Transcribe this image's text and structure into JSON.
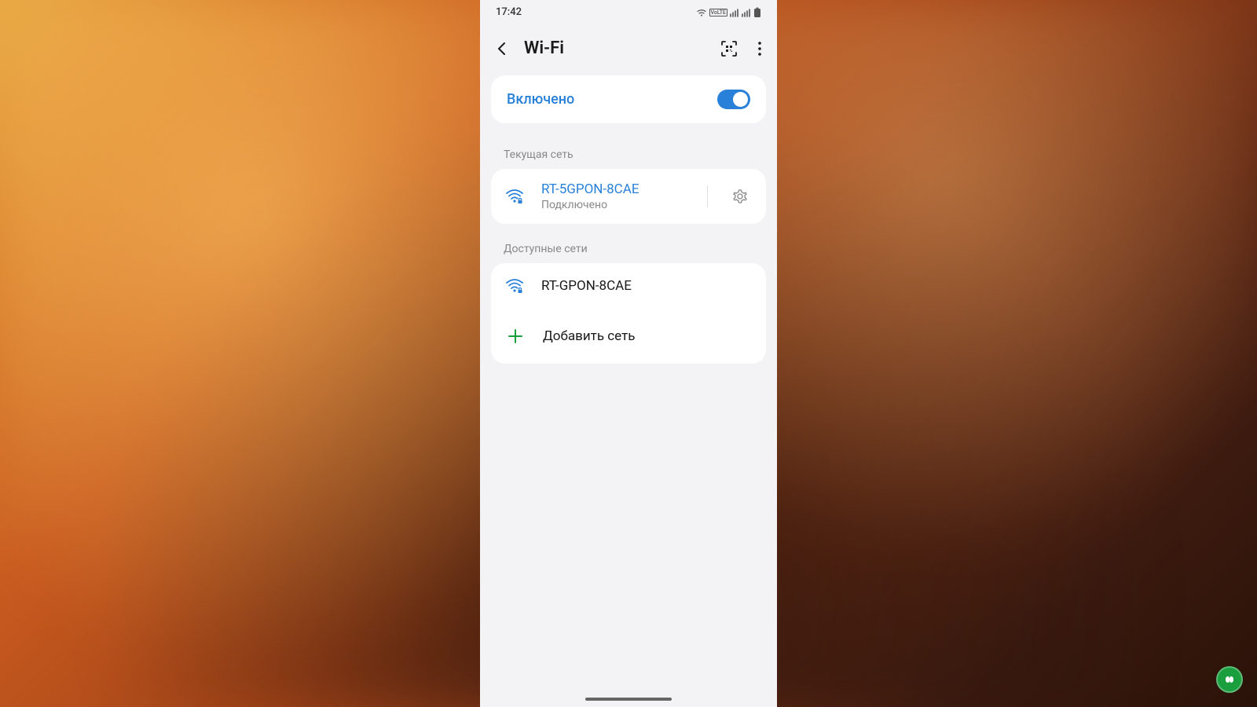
{
  "statusbar": {
    "time": "17:42"
  },
  "header": {
    "title": "Wi-Fi"
  },
  "toggle": {
    "label": "Включено",
    "enabled": true
  },
  "sections": {
    "current_label": "Текущая сеть",
    "available_label": "Доступные сети"
  },
  "current_network": {
    "name": "RT-5GPON-8CAE",
    "status": "Подключено"
  },
  "available_networks": [
    {
      "name": "RT-GPON-8CAE"
    }
  ],
  "add_network": {
    "label": "Добавить сеть"
  },
  "colors": {
    "accent": "#2980d9",
    "plus": "#1a9e3e"
  }
}
